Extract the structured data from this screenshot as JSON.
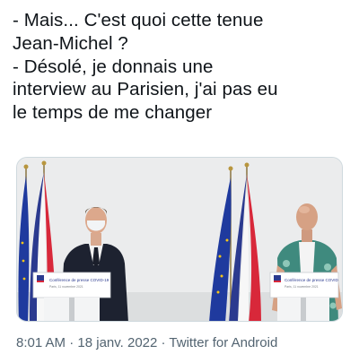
{
  "tweet": {
    "text_lines": [
      "- Mais... C'est quoi cette tenue",
      "Jean-Michel ?",
      "- Désolé, je donnais une",
      "interview au Parisien, j'ai pas eu",
      "le temps de me changer"
    ]
  },
  "media": {
    "left_podium_sign": "Conférence de presse COVID-19",
    "left_podium_date": "Paris, 11 novembre 2021",
    "right_podium_sign": "Conférence de presse COVID",
    "right_podium_date": "Paris, 11 novembre 2021"
  },
  "meta": {
    "time": "8:01 AM",
    "separator1": " · ",
    "date": "18 janv. 2022",
    "separator2": " · ",
    "source": "Twitter for Android"
  },
  "colors": {
    "text": "#0f1419",
    "meta_text": "#536471",
    "flag_blue": "#2b3a8f",
    "flag_red": "#d8283a",
    "eu_blue": "#1f3a9e",
    "eu_star": "#f5c518"
  }
}
